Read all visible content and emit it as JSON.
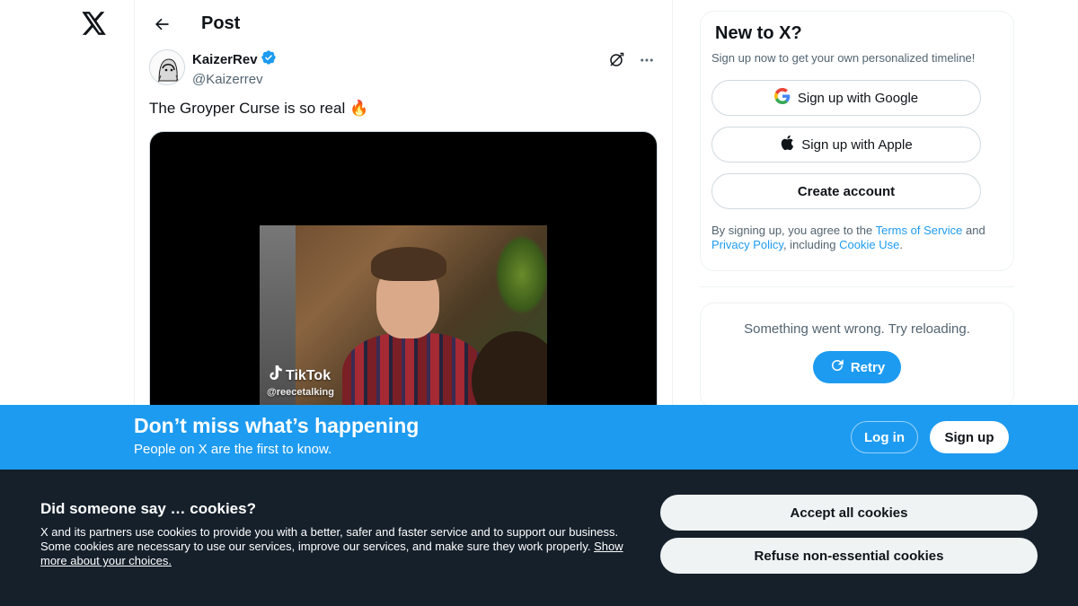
{
  "nav": {
    "logo_icon": "x-logo-icon"
  },
  "header": {
    "back_icon": "arrow-left-icon",
    "title": "Post"
  },
  "tweet": {
    "author_name": "KaizerRev",
    "author_handle": "@Kaizerrev",
    "verified": true,
    "text": "The Groyper Curse is so real",
    "emoji": "🔥",
    "media": {
      "watermark": "TikTok",
      "watermark_handle": "@reecetalking"
    }
  },
  "sidebar": {
    "signup": {
      "title": "New to X?",
      "subtitle": "Sign up now to get your own personalized timeline!",
      "google_label": "Sign up with Google",
      "apple_label": "Sign up with Apple",
      "create_label": "Create account",
      "legal_prefix": "By signing up, you agree to the ",
      "terms": "Terms of Service",
      "and": " and ",
      "privacy": "Privacy Policy",
      "including": ", including ",
      "cookie_use": "Cookie Use",
      "period": "."
    },
    "error": {
      "text": "Something went wrong. Try reloading.",
      "retry_label": "Retry"
    }
  },
  "banner": {
    "title": "Don’t miss what’s happening",
    "subtitle": "People on X are the first to know.",
    "login_label": "Log in",
    "signup_label": "Sign up"
  },
  "cookie": {
    "title": "Did someone say … cookies?",
    "body": "X and its partners use cookies to provide you with a better, safer and faster service and to support our business. Some cookies are necessary to use our services, improve our services, and make sure they work properly. ",
    "link": "Show more about your choices.",
    "accept_label": "Accept all cookies",
    "refuse_label": "Refuse non-essential cookies"
  },
  "colors": {
    "accent": "#1d9bf0",
    "cookie_bg": "#15202b",
    "text": "#0f1419",
    "muted": "#536471"
  }
}
